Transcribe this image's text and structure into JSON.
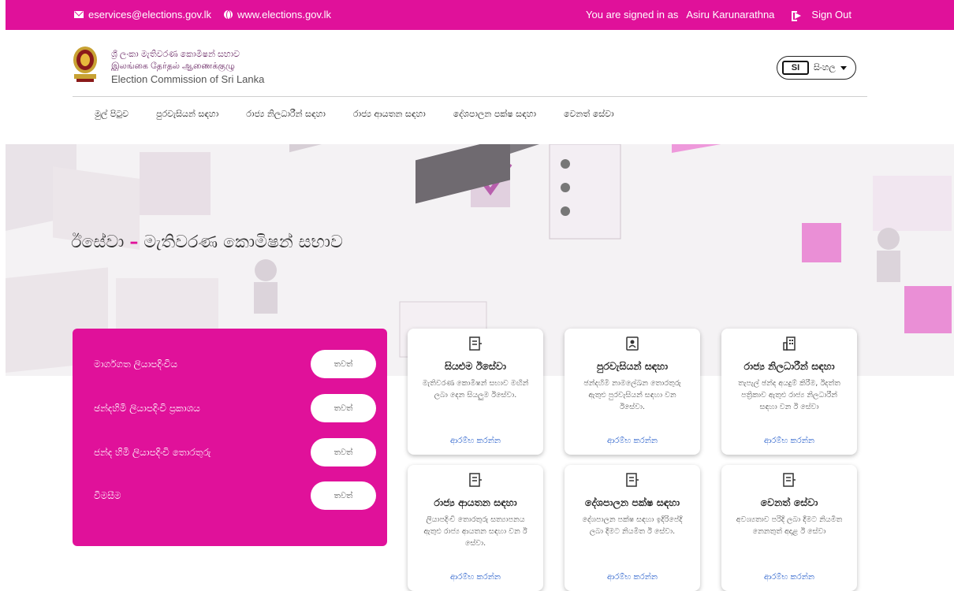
{
  "topbar": {
    "email": "eservices@elections.gov.lk",
    "website": "www.elections.gov.lk",
    "signed_in_label": "You are signed in as",
    "user_name": "Asiru Karunarathna",
    "sign_out": "Sign Out"
  },
  "brand": {
    "sinhala": "ශ්‍රී ලංකා මැතිවරණ කොමිෂන් සභාව",
    "tamil": "இலங்கை தேர்தல் ஆணைக்குழு",
    "english": "Election Commission of Sri Lanka"
  },
  "language": {
    "code": "SI",
    "label": "සිංහල"
  },
  "nav": [
    "මුල් පිටුව",
    "පුරවැසියන් සඳහා",
    "රාජ්‍ය නිලධාරීන් සඳහා",
    "රාජ්‍ය ආයතන සඳහා",
    "දේශපාලන පක්ෂ සඳහා",
    "වෙනත් සේවා"
  ],
  "hero": {
    "title_part1": "ඊසේවා",
    "dash": "–",
    "title_part2": "මැතිවරණ කොමිෂන් සභාව"
  },
  "panel": {
    "items": [
      {
        "label": "මාර්ගගත ලියාපදිංචිය",
        "button": "තවත්"
      },
      {
        "label": "ඡන්දහිමි ලියාපදිංචි ප්‍රකාශය",
        "button": "තවත්"
      },
      {
        "label": "ජන්ද හිමි ලියාපදිංචි තොරතුරු",
        "button": "තවත්"
      },
      {
        "label": "විමසීම",
        "button": "තවත්"
      }
    ]
  },
  "cards": [
    {
      "title": "සියළුම ඊසේවා",
      "desc": "මැතිවරණ කොමිෂන් සභාව මඟින් ලබා දෙන සියලුම ඊසේවා.",
      "link": "ආරම්භ කරන්න"
    },
    {
      "title": "පුරවැසියන් සඳහා",
      "desc": "ඡන්දහිමි නාමලේඛන තොරතුරු ඇතුළු පුරවැසියන් සඳහා වන ඊසේවා.",
      "link": "ආරම්භ කරන්න"
    },
    {
      "title": "රාජ්‍ය නිලධාරීන් සඳහා",
      "desc": "තැපැල් ඡන්ද අයදුම් කිරීම, ඊදත්ත පත්‍රිකාව ඇතුළු රාජ්‍ය නිලධාරීන් සඳහා වන ඊ සේවා",
      "link": "ආරම්භ කරන්න"
    },
    {
      "title": "රාජ්‍ය ආයතන සඳහා",
      "desc": "ලියාපදිංචි තොරතුරු සත්‍යාපනය ඇතුළු රාජ්‍ය ආයතන සඳහා වන ඊ සේවා.",
      "link": "ආරම්භ කරන්න"
    },
    {
      "title": "දේශපාලන පක්ෂ සඳහා",
      "desc": "දේශපාලන පක්ෂ සඳහා ඉදිරිපේදි ලබා දීමට නියමිත ඊ සේවා.",
      "link": "ආරම්භ කරන්න"
    },
    {
      "title": "වෙනත් සේවා",
      "desc": "අවශ්‍යතාව පරිදි ලබා දීමට නියමිත නෙනතුත් අදාළ ඊ සේවා",
      "link": "ආරම්භ කරන්න"
    }
  ],
  "colors": {
    "brand": "#e0119a",
    "link": "#1a55c8"
  }
}
